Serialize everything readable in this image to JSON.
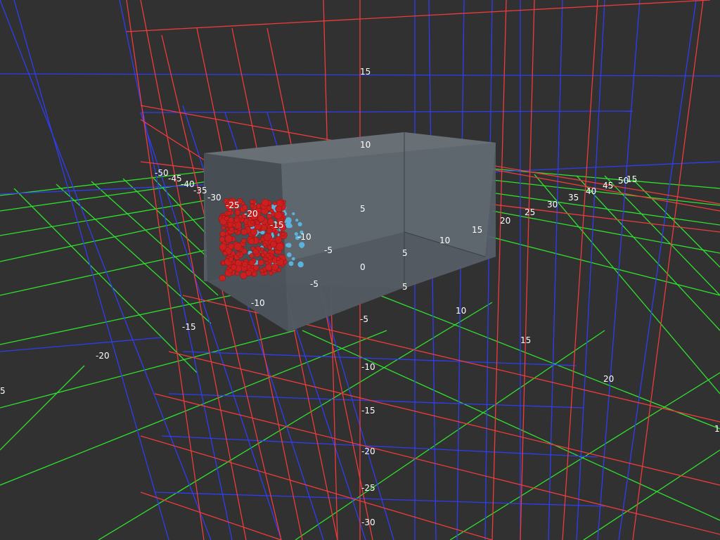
{
  "viewport": {
    "background": "#313131",
    "grid_colors": {
      "xy_plane": "#2f3df2",
      "yz_plane": "#ef3b3b",
      "xz_plane": "#2fe02f"
    },
    "box_color": "#5a6266",
    "particle_colors": {
      "red": "#cc1f1f",
      "blue": "#5ab3dc"
    }
  },
  "axes": {
    "vertical": [
      "15",
      "10",
      "5",
      "0",
      "-5",
      "-10",
      "-15",
      "-20",
      "-25",
      "-30"
    ],
    "depth": [
      "-50",
      "-45",
      "-40",
      "-35",
      "-30",
      "-25",
      "-20",
      "-15",
      "-10",
      "-5",
      "5",
      "10",
      "15",
      "20",
      "25",
      "30",
      "35",
      "40",
      "45",
      "50"
    ],
    "horizontal": [
      "-15",
      "-20",
      "5",
      "10",
      "15",
      "20",
      "-10",
      "-5",
      "5",
      "10",
      "15"
    ],
    "corner_labels": [
      "5",
      "-15",
      "-10",
      "-5",
      "0",
      "5",
      "5"
    ]
  }
}
